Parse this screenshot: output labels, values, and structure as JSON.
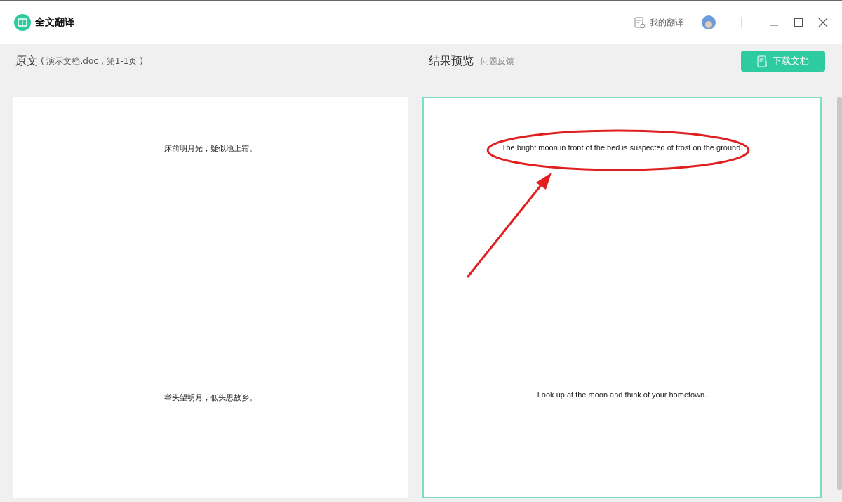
{
  "window": {
    "title": "全文翻译"
  },
  "header": {
    "my_translations": "我的翻译"
  },
  "source": {
    "title": "原文",
    "subtitle": "( 演示文档.doc，第1-1页 )",
    "lines": [
      "床前明月光，疑似地上霜。",
      "举头望明月，低头思故乡。"
    ]
  },
  "result": {
    "title": "结果预览",
    "feedback_link": "问题反馈",
    "download_button": "下载文档",
    "lines": [
      "The bright moon in front of the bed is suspected of frost on the ground.",
      "Look up at the moon and think of your hometown."
    ]
  }
}
